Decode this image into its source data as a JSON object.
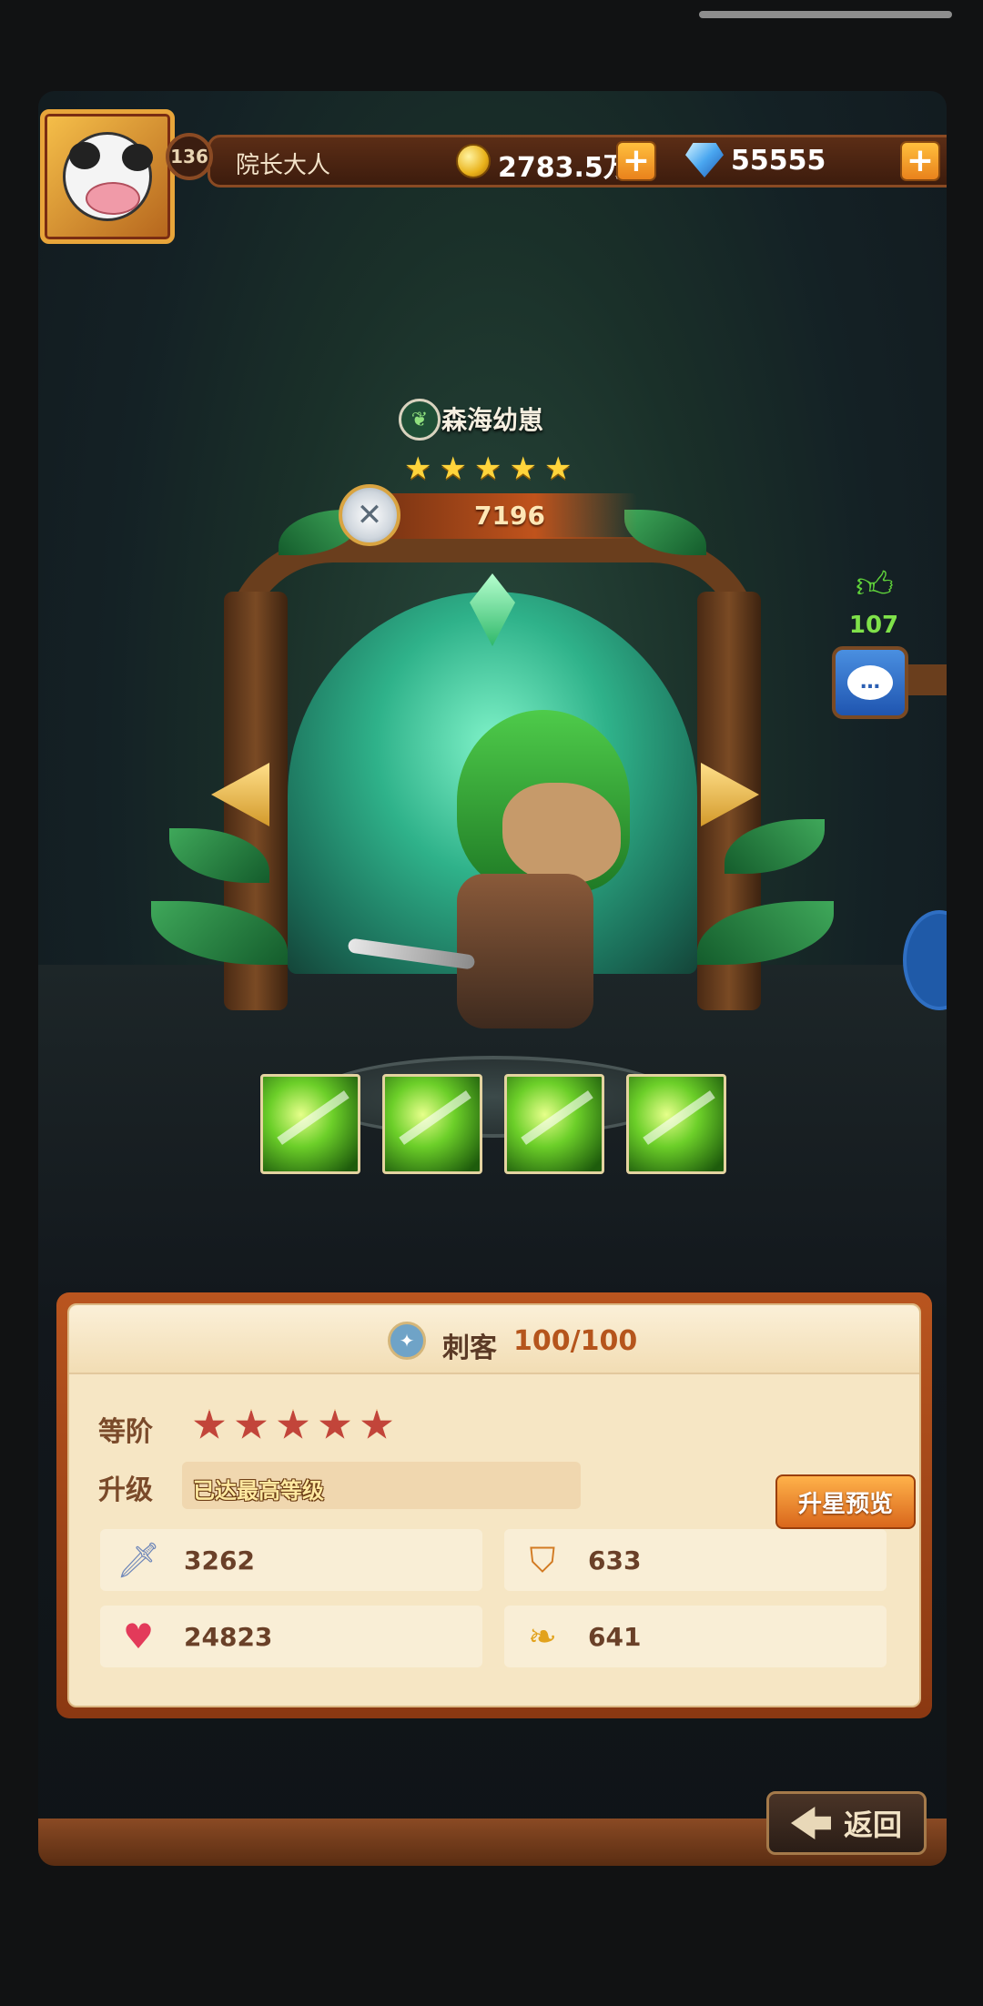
{
  "header": {
    "level": "136",
    "player_name": "院长大人",
    "gold": "2783.5万",
    "diamonds": "55555",
    "plus_label": "+"
  },
  "hero": {
    "name": "森海幼崽",
    "stars": [
      "★",
      "★",
      "★",
      "★",
      "★"
    ],
    "power": "7196",
    "element_icon": "leaf-icon"
  },
  "social": {
    "likes": "107",
    "chat_icon": "…"
  },
  "skills": [
    {
      "icon": "claw-slash-skill-icon"
    },
    {
      "icon": "triple-slash-skill-icon"
    },
    {
      "icon": "shadow-face-skill-icon"
    },
    {
      "icon": "wolf-howl-skill-icon"
    }
  ],
  "info": {
    "class_name": "刺客",
    "class_progress": "100/100",
    "rank_label": "等阶",
    "upgrade_label": "升级",
    "upgrade_status": "已达最高等级",
    "preview_button": "升星预览"
  },
  "stats": [
    {
      "icon": "sword-icon",
      "value": "3262"
    },
    {
      "icon": "shield-icon",
      "value": "633"
    },
    {
      "icon": "heart-icon",
      "value": "24823"
    },
    {
      "icon": "wing-icon",
      "value": "641"
    }
  ],
  "footer": {
    "back_label": "返回"
  },
  "colors": {
    "accent": "#e9821c",
    "panel": "#f6e6c4",
    "like": "#7fe14a"
  }
}
